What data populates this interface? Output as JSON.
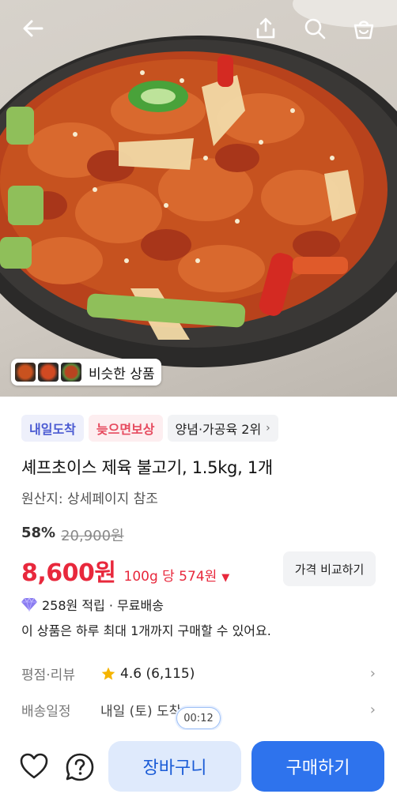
{
  "hero": {
    "similar_label": "비슷한 상품"
  },
  "icons": {
    "back": "arrow-left-icon",
    "share": "share-icon",
    "search": "search-icon",
    "cart": "shopping-bag-icon",
    "rating": "star-icon",
    "reward": "gem-icon",
    "wishlist": "heart-icon",
    "help": "question-icon"
  },
  "badges": {
    "arrival": "내일도착",
    "late_comp": "늦으면보상",
    "rank": "양념·가공육 2위"
  },
  "product": {
    "title": "셰프초이스 제육 불고기, 1.5kg, 1개",
    "origin": "원산지: 상세페이지 참조"
  },
  "pricing": {
    "discount": "58%",
    "original_price": "20,900원",
    "price": "8,600원",
    "unit_price": "100g 당 574원",
    "compare_label": "가격 비교하기"
  },
  "benefits": {
    "reward": "258원 적립 · 무료배송",
    "limit": "이 상품은 하루 최대 1개까지 구매할 수 있어요."
  },
  "rating": {
    "label": "평점·리뷰",
    "value": "4.6 (6,115)"
  },
  "shipping": {
    "label": "배송일정",
    "value": "내일 (토) 도착"
  },
  "timer": "00:12",
  "actions": {
    "cart": "장바구니",
    "buy": "구매하기"
  },
  "colors": {
    "price_red": "#e8283c",
    "buy_blue": "#2e73ed",
    "cart_bg": "#dfeafc",
    "badge_blue": "#4a5ad2",
    "badge_pink": "#e64b5f"
  }
}
